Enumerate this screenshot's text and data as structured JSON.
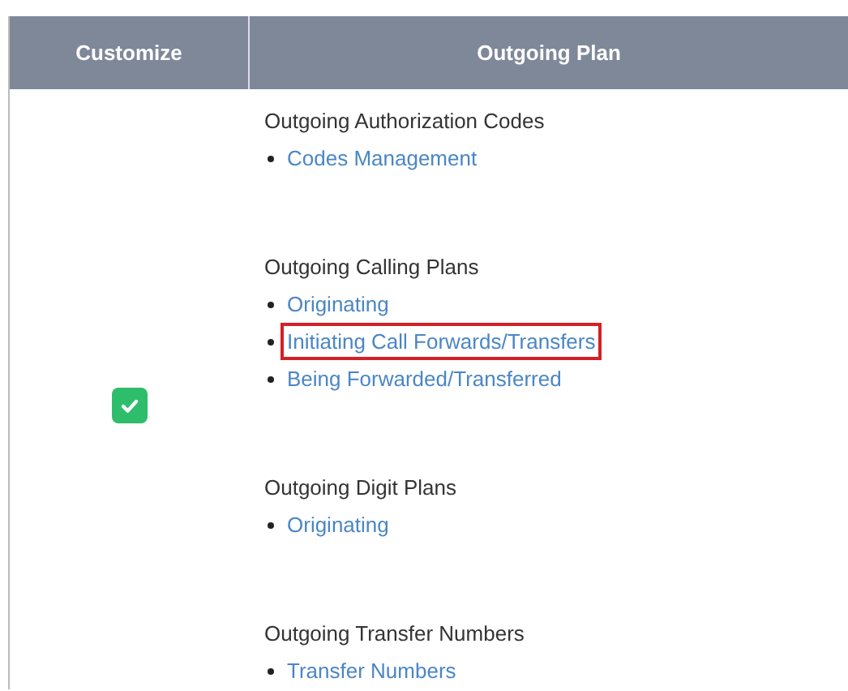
{
  "table": {
    "columns": [
      "Customize",
      "Outgoing Plan"
    ],
    "rows": [
      {
        "customize_checked": true,
        "groups": [
          {
            "title": "Outgoing Authorization Codes",
            "links": [
              {
                "label": "Codes Management",
                "highlighted": false
              }
            ]
          },
          {
            "title": "Outgoing Calling Plans",
            "links": [
              {
                "label": "Originating",
                "highlighted": false
              },
              {
                "label": "Initiating Call Forwards/Transfers",
                "highlighted": true
              },
              {
                "label": "Being Forwarded/Transferred",
                "highlighted": false
              }
            ]
          },
          {
            "title": "Outgoing Digit Plans",
            "links": [
              {
                "label": "Originating",
                "highlighted": false
              }
            ]
          },
          {
            "title": "Outgoing Transfer Numbers",
            "links": [
              {
                "label": "Transfer Numbers",
                "highlighted": false
              }
            ]
          }
        ]
      }
    ]
  }
}
